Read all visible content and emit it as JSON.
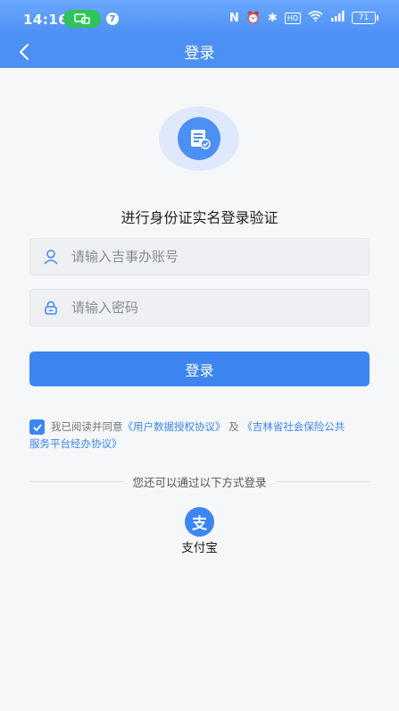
{
  "status": {
    "time": "14:16",
    "notification_count": "7",
    "battery": "71"
  },
  "nav": {
    "title": "登录"
  },
  "main": {
    "headline": "进行身份证实名登录验证",
    "account_placeholder": "请输入吉事办账号",
    "password_placeholder": "请输入密码",
    "login_label": "登录"
  },
  "agreement": {
    "prefix": "我已阅读并同意",
    "link1": "《用户数据授权协议》",
    "conjunction": "及",
    "link2_part1": "《吉林省社会保险公共",
    "link2_part2": "服务平台经办协议》"
  },
  "alt_login": {
    "divider_text": "您还可以通过以下方式登录",
    "alipay_label": "支付宝",
    "alipay_glyph": "支"
  },
  "colors": {
    "primary": "#3d86f2",
    "nav": "#4d90f4",
    "background": "#f6f7f9"
  }
}
